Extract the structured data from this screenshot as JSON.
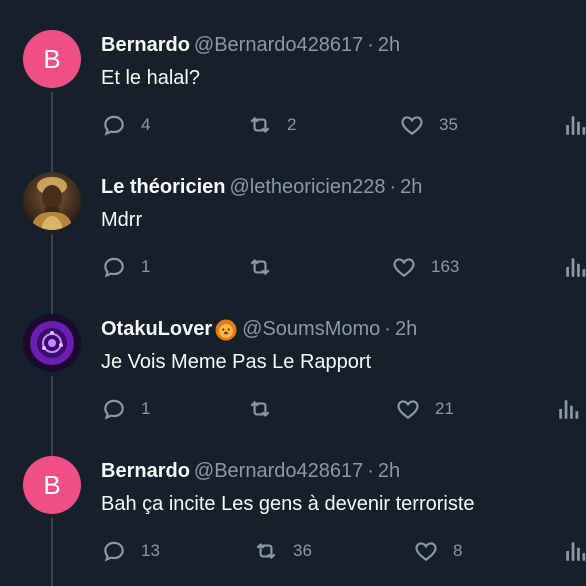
{
  "tweets": [
    {
      "avatar_letter": "B",
      "avatar_color": "#f04f86",
      "name": "Bernardo",
      "handle": "@Bernardo428617",
      "time": "2h",
      "text": "Et le halal?",
      "replies": "4",
      "retweets": "2",
      "likes": "35"
    },
    {
      "avatar_letter": "",
      "name": "Le théoricien",
      "handle": "@letheoricien228",
      "time": "2h",
      "text": "Mdrr",
      "replies": "1",
      "retweets": "",
      "likes": "163"
    },
    {
      "avatar_letter": "",
      "name": "OtakuLover",
      "handle": "@SoumsMomo",
      "time": "2h",
      "text": "Je Vois Meme Pas Le Rapport",
      "replies": "1",
      "retweets": "",
      "likes": "21"
    },
    {
      "avatar_letter": "B",
      "avatar_color": "#f04f86",
      "name": "Bernardo",
      "handle": "@Bernardo428617",
      "time": "2h",
      "text": "Bah ça incite Les gens à devenir terroriste",
      "replies": "13",
      "retweets": "36",
      "likes": "8"
    }
  ],
  "separator": "·",
  "icons": [
    "reply-icon",
    "retweet-icon",
    "like-icon",
    "views-icon",
    "lion-emoji-icon"
  ],
  "colors": {
    "background": "#15202b",
    "text": "#f7f9f9",
    "muted": "#8b98a5",
    "thread_line": "#38444d"
  }
}
